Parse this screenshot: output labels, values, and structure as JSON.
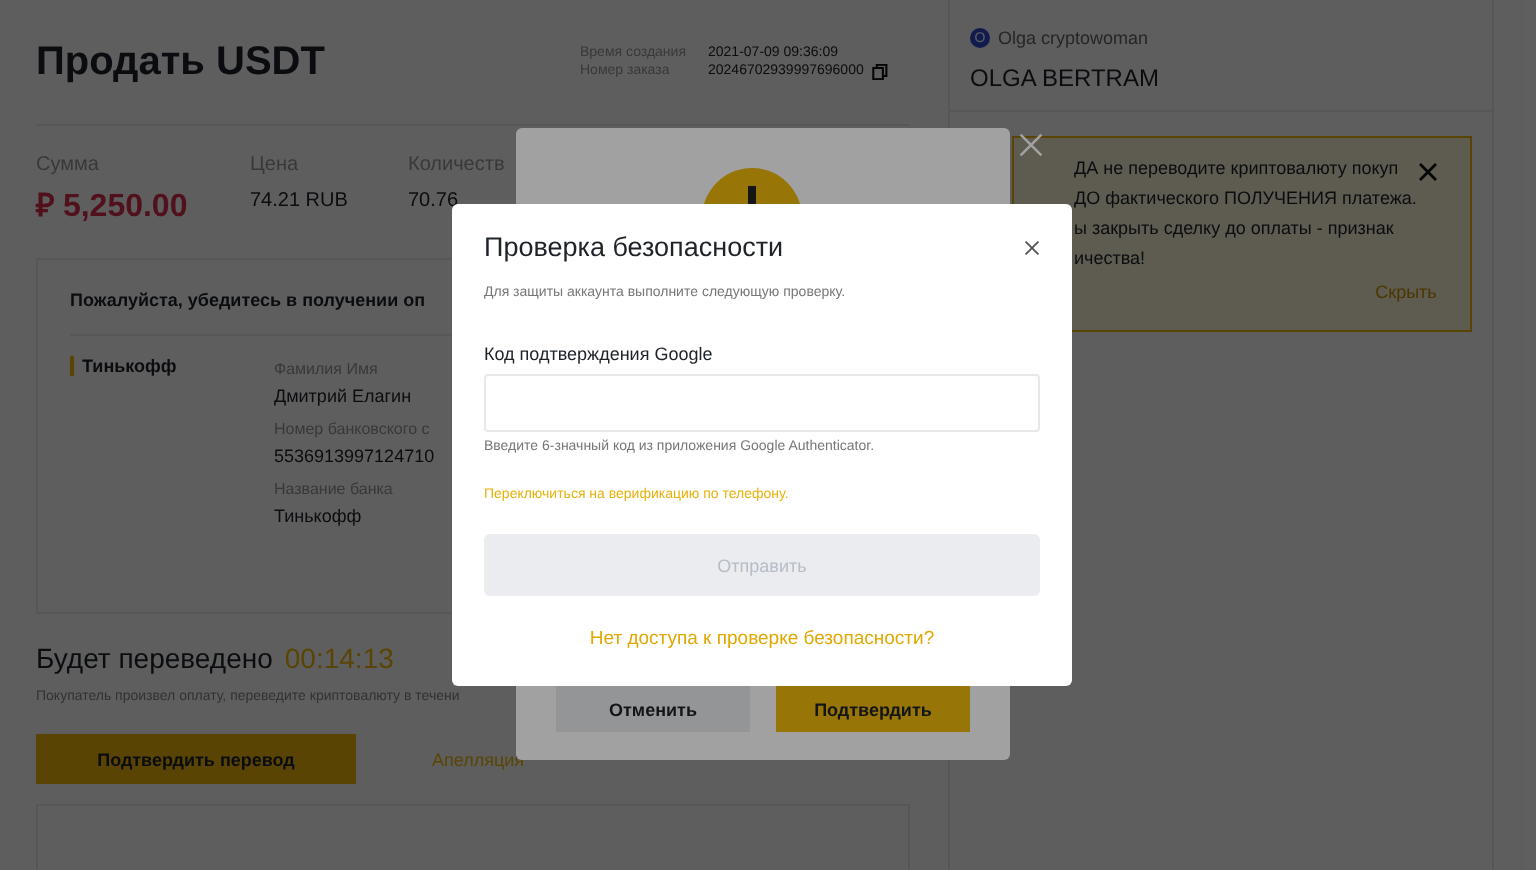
{
  "page": {
    "title": "Продать USDT",
    "meta": [
      {
        "label": "Время создания",
        "value": "2021-07-09 09:36:09"
      },
      {
        "label": "Номер заказа",
        "value": "20246702939997696000"
      }
    ],
    "stats": [
      {
        "label": "Сумма",
        "value": "₽ 5,250.00",
        "kind": "total"
      },
      {
        "label": "Цена",
        "value": "74.21 RUB",
        "kind": "plain"
      },
      {
        "label": "Количеств",
        "value": "70.76",
        "kind": "plain"
      }
    ],
    "payment_card": {
      "title": "Пожалуйста, убедитесь в получении оп",
      "method": "Тинькофф",
      "fields": [
        {
          "label": "Фамилия Имя",
          "value": "Дмитрий Елагин"
        },
        {
          "label": "Номер банковского с",
          "value": "5536913997124710"
        },
        {
          "label": "Название банка",
          "value": "Тинькофф"
        }
      ]
    },
    "transfer": {
      "title": "Будет переведено",
      "timer": "00:14:13",
      "note": "Покупатель произвел оплату, переведите криптовалюту в течени",
      "confirm_button": "Подтвердить перевод",
      "appeal_link": "Апелляция"
    }
  },
  "seller": {
    "avatar": "O",
    "nickname": "Olga cryptowoman",
    "name": "OLGA BERTRAM"
  },
  "notice": {
    "lines": [
      "ДА не переводите криптовалюту покуп",
      "ДО фактического ПОЛУЧЕНИЯ платежа.",
      "ы закрыть сделку до оплаты - признак",
      "ичества!"
    ],
    "hide_link": "Скрыть"
  },
  "confirm_dialog": {
    "buttons": [
      {
        "label": "Отменить",
        "kind": "secondary"
      },
      {
        "label": "Подтвердить",
        "kind": "primary"
      }
    ]
  },
  "security_dialog": {
    "title": "Проверка безопасности",
    "subtitle": "Для защиты аккаунта выполните следующую проверку.",
    "field_label": "Код подтверждения Google",
    "hint": "Введите 6-значный код из приложения Google Authenticator.",
    "switch_link": "Переключиться на верификацию по телефону.",
    "submit": {
      "label": "Отправить",
      "disabled": true
    },
    "no_access_link": "Нет доступа к проверке безопасности?"
  }
}
